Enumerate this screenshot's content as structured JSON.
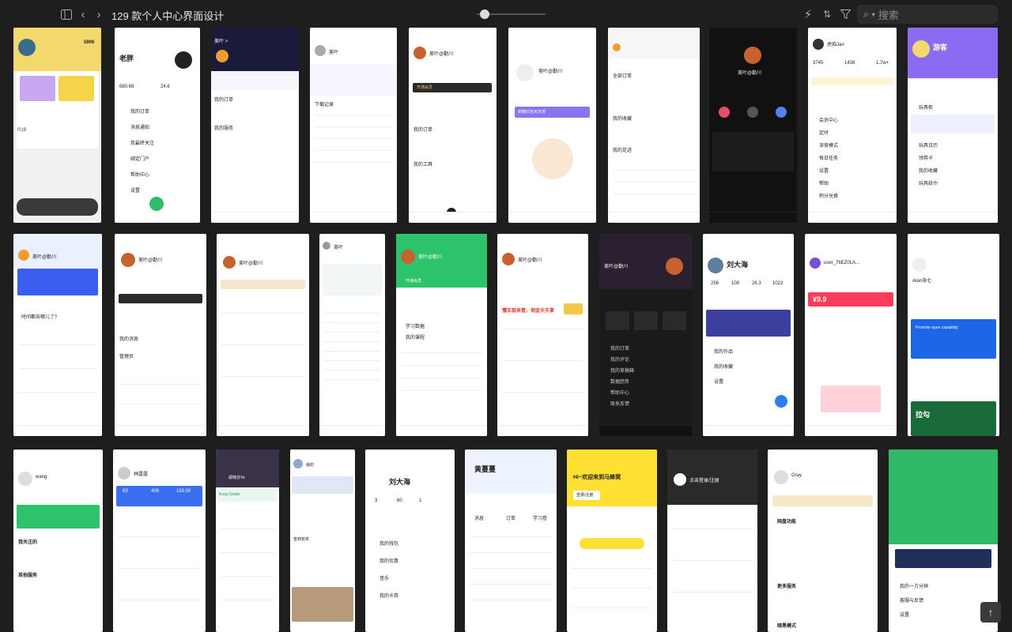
{
  "window": {
    "title": "129 款个人中心界面设计",
    "search_placeholder": "搜索"
  },
  "icons": {
    "sidebar": "sidebar-toggle-icon",
    "back": "chevron-left-icon",
    "forward": "chevron-right-icon",
    "flash": "lightning-icon",
    "sort": "sort-icon",
    "filter": "filter-icon",
    "search": "search-icon",
    "top": "arrow-up-icon"
  },
  "accent": "#ffffff",
  "shots": {
    "r1c1": {
      "num": "5906",
      "name": "R1B"
    },
    "r1c2": {
      "name": "老胖",
      "stat1": "680.68",
      "stat2": "24.6",
      "items": [
        "我的订单",
        "消息通知",
        "我最终关注",
        "绑定门户",
        "帮助中心",
        "设置"
      ]
    },
    "r1c3": {
      "name": "美叶 >",
      "items": [
        "我的订单",
        "我的服务"
      ]
    },
    "r1c4": {
      "name": "美叶",
      "items": [
        "下载记录",
        "我的喜欢"
      ]
    },
    "r1c5": {
      "name": "美叶@勤川",
      "vip": "开通会员",
      "items": [
        "我的订单",
        "我的工具"
      ]
    },
    "r1c6": {
      "name": "美叶@勤川",
      "promo": "荣耀红包天天领"
    },
    "r1c7": {
      "items": [
        "全部订单",
        "我的收藏",
        "我的足迹"
      ]
    },
    "r1c8": {
      "name": "美叶@勤川"
    },
    "r1c9": {
      "name": "虎焰Jari",
      "s1": "3745",
      "s2": "1438",
      "s3": "1.7w+",
      "items": [
        "会员中心",
        "定时",
        "深夜模式",
        "每日任务",
        "设置",
        "帮助",
        "积分兑换"
      ]
    },
    "r1c10": {
      "name": "游客",
      "items": [
        "玩具柜",
        "玩具日历",
        "领券卡",
        "我的收藏",
        "玩具纸巾"
      ]
    },
    "r2c1": {
      "name": "美叶@勤川",
      "sub": "时间都去哪儿了?"
    },
    "r2c2": {
      "name": "美叶@勤川",
      "items": [
        "我的消息",
        "管理员"
      ]
    },
    "r2c3": {
      "name": "美叶@勤川"
    },
    "r2c4": {
      "name": "美叶"
    },
    "r2c5": {
      "name": "美叶@勤川",
      "items": [
        "开通会员",
        "学习数据",
        "我的课程"
      ]
    },
    "r2c6": {
      "name": "美叶@勤川",
      "promo": "懂车就来看，佣金天天拿"
    },
    "r2c7": {
      "name": "美叶@勤川",
      "items": [
        "我的订单",
        "我的评论",
        "我的草稿箱",
        "数据趋势",
        "帮助中心",
        "联系反馈"
      ]
    },
    "r2c8": {
      "name": "刘大海",
      "s1": "256",
      "s2": "108",
      "s3": "26.3",
      "s4": "1022",
      "items": [
        "我的作品",
        "我的收藏",
        "设置"
      ]
    },
    "r2c9": {
      "name": "user_76EZ0LA...",
      "promo": "¥9.9"
    },
    "r2c10": {
      "name": "Alan海七",
      "card": "Promote open capability",
      "art": "拉勾"
    },
    "r3c1": {
      "name": "wang",
      "items": [
        "我关注的",
        "其他服务"
      ]
    },
    "r3c2": {
      "name": "林露露",
      "s1": "83",
      "s2": "409",
      "s3": "159.00"
    },
    "r3c3": {
      "name": "胡特亦Ye",
      "grade": "Keep Grade"
    },
    "r3c4": {
      "name": "我的",
      "items": [
        "签到有奖"
      ]
    },
    "r3c5": {
      "name": "刘大海",
      "s1": "3",
      "s2": "60",
      "s3": "1",
      "items": [
        "我的钱包",
        "我的优惠",
        "音乐",
        "我的卡券"
      ]
    },
    "r3c6": {
      "name": "黄蔓蔓",
      "items": [
        "消息",
        "订单",
        "学习卷"
      ]
    },
    "r3c7": {
      "banner": "Hi~欢迎来到马蜂窝",
      "btn": "登录/注册"
    },
    "r3c8": {
      "name": "点击登录/注册"
    },
    "r3c9": {
      "name": "Gray",
      "items": [
        "网盘功能",
        "更多服务",
        "暗黑模式"
      ]
    },
    "r3c10": {
      "items": [
        "我的一方分钟",
        "客服与反馈",
        "设置"
      ]
    }
  }
}
